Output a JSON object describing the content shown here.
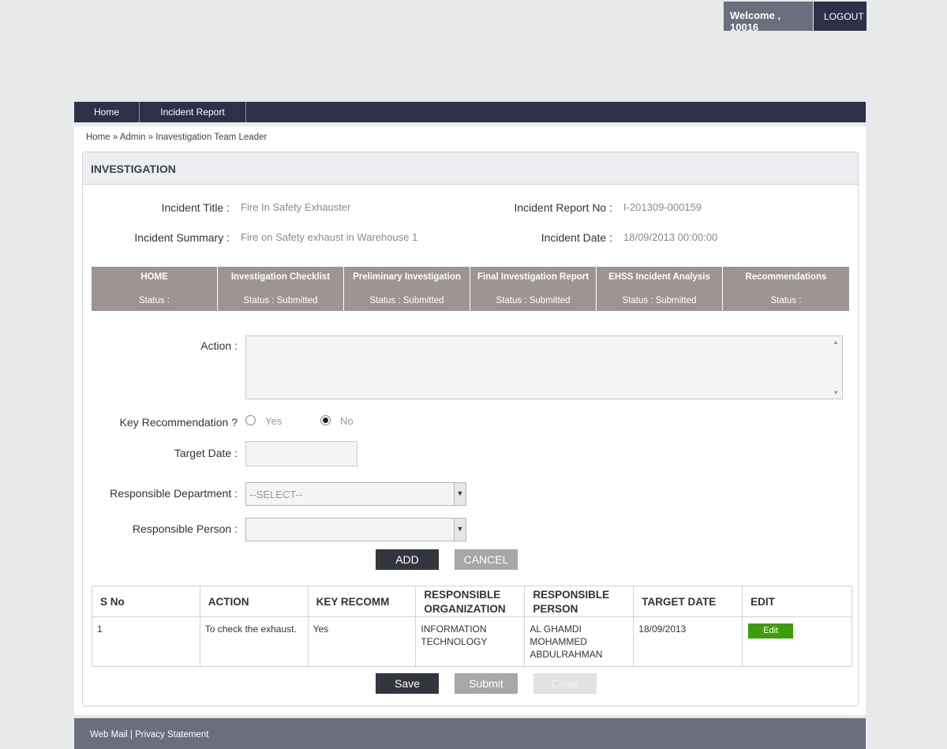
{
  "header": {
    "welcome": "Welcome , 10016",
    "logout": "LOGOUT"
  },
  "nav": {
    "home": "Home",
    "incident_report": "Incident Report"
  },
  "breadcrumb": {
    "home": "Home",
    "sep": " » ",
    "admin": "Admin",
    "current": "Inavestigation Team Leader"
  },
  "panel": {
    "title": "INVESTIGATION"
  },
  "incident": {
    "title_label": "Incident Title :",
    "title_value": "Fire In Safety Exhauster",
    "summary_label": "Incident Summary :",
    "summary_value": "Fire on Safety exhaust in Warehouse 1",
    "report_no_label": "Incident Report No :",
    "report_no_value": "I-201309-000159",
    "date_label": "Incident Date :",
    "date_value": "18/09/2013 00:00:00"
  },
  "status_tabs": [
    {
      "title": "HOME",
      "status": "Status :"
    },
    {
      "title": "Investigation Checklist",
      "status": "Status : Submitted"
    },
    {
      "title": "Preliminary Investigation",
      "status": "Status : Submitted"
    },
    {
      "title": "Final Investigation Report",
      "status": "Status : Submitted"
    },
    {
      "title": "EHSS Incident Analysis",
      "status": "Status : Submitted"
    },
    {
      "title": "Recommendations",
      "status": "Status :"
    }
  ],
  "form": {
    "action_label": "Action :",
    "key_rec_label": "Key Recommendation ?",
    "yes_label": "Yes",
    "no_label": "No",
    "selected": "No",
    "target_date_label": "Target Date :",
    "resp_dept_label": "Responsible Department :",
    "resp_dept_value": "--SELECT--",
    "resp_person_label": "Responsible Person :",
    "resp_person_value": "",
    "add_button": "ADD",
    "cancel_button": "CANCEL"
  },
  "table": {
    "headers": [
      "S No",
      "ACTION",
      "KEY RECOMM",
      "RESPONSIBLE ORGANIZATION",
      "RESPONSIBLE PERSON",
      "TARGET DATE",
      "EDIT"
    ],
    "rows": [
      {
        "sno": "1",
        "action": "To check the exhaust.",
        "key": "Yes",
        "org": "INFORMATION TECHNOLOGY",
        "person": "AL GHAMDI MOHAMMED ABDULRAHMAN",
        "date": "18/09/2013",
        "edit": "Edit"
      }
    ]
  },
  "bottom_buttons": {
    "save": "Save",
    "submit": "Submit",
    "close": "Close"
  },
  "footer": {
    "webmail": "Web Mail",
    "sep": " | ",
    "privacy": "Privacy Statement"
  },
  "colors": {
    "nav_bg": "#2e3048",
    "status_bg": "#9d9493",
    "edit_green": "#3e9e0a",
    "footer_bg": "#6b6e7c"
  }
}
